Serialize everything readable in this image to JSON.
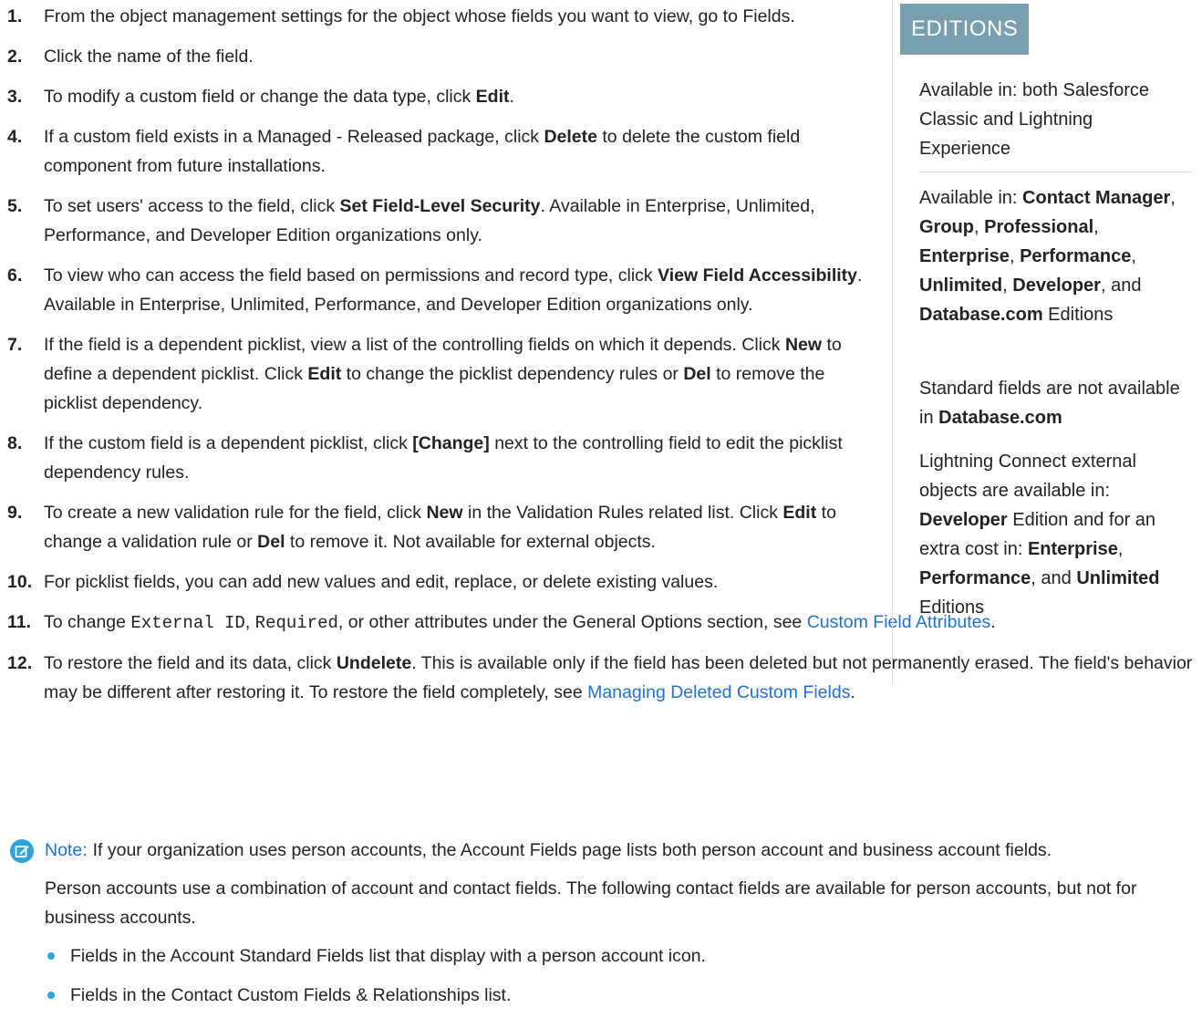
{
  "steps": [
    {
      "num": "1.",
      "parts": [
        {
          "t": "From the object management settings for the object whose fields you want to view, go to Fields."
        }
      ]
    },
    {
      "num": "2.",
      "parts": [
        {
          "t": "Click the name of the field."
        }
      ]
    },
    {
      "num": "3.",
      "parts": [
        {
          "t": "To modify a custom field or change the data type, click "
        },
        {
          "t": "Edit",
          "b": true
        },
        {
          "t": "."
        }
      ]
    },
    {
      "num": "4.",
      "parts": [
        {
          "t": "If a custom field exists in a Managed - Released package, click "
        },
        {
          "t": "Delete",
          "b": true
        },
        {
          "t": " to delete the custom field component from future installations."
        }
      ]
    },
    {
      "num": "5.",
      "parts": [
        {
          "t": "To set users' access to the field, click "
        },
        {
          "t": "Set Field-Level Security",
          "b": true
        },
        {
          "t": ". Available in Enterprise, Unlimited, Performance, and Developer Edition organizations only."
        }
      ]
    },
    {
      "num": "6.",
      "parts": [
        {
          "t": "To view who can access the field based on permissions and record type, click "
        },
        {
          "t": "View Field Accessibility",
          "b": true
        },
        {
          "t": ". Available in Enterprise, Unlimited, Performance, and Developer Edition organizations only."
        }
      ]
    },
    {
      "num": "7.",
      "parts": [
        {
          "t": "If the field is a dependent picklist, view a list of the controlling fields on which it depends. Click "
        },
        {
          "t": "New",
          "b": true
        },
        {
          "t": " to define a dependent picklist. Click "
        },
        {
          "t": "Edit",
          "b": true
        },
        {
          "t": " to change the picklist dependency rules or "
        },
        {
          "t": "Del",
          "b": true
        },
        {
          "t": " to remove the picklist dependency."
        }
      ]
    },
    {
      "num": "8.",
      "parts": [
        {
          "t": "If the custom field is a dependent picklist, click "
        },
        {
          "t": "[Change]",
          "b": true
        },
        {
          "t": " next to the controlling field to edit the picklist dependency rules."
        }
      ]
    },
    {
      "num": "9.",
      "parts": [
        {
          "t": "To create a new validation rule for the field, click "
        },
        {
          "t": "New",
          "b": true
        },
        {
          "t": " in the Validation Rules related list. Click "
        },
        {
          "t": "Edit",
          "b": true
        },
        {
          "t": " to change a validation rule or "
        },
        {
          "t": "Del",
          "b": true
        },
        {
          "t": " to remove it. Not available for external objects."
        }
      ]
    },
    {
      "num": "10.",
      "parts": [
        {
          "t": "For picklist fields, you can add new values and edit, replace, or delete existing values."
        }
      ]
    },
    {
      "num": "11.",
      "parts": [
        {
          "t": "To change "
        },
        {
          "t": "External ID",
          "m": true
        },
        {
          "t": ", "
        },
        {
          "t": "Required",
          "m": true
        },
        {
          "t": ", or other attributes under the General Options section, see "
        },
        {
          "t": "Custom Field Attributes",
          "l": true
        },
        {
          "t": "."
        }
      ]
    },
    {
      "num": "12.",
      "parts": [
        {
          "t": "To restore the field and its data, click "
        },
        {
          "t": "Undelete",
          "b": true
        },
        {
          "t": ". This is available only if the field has been deleted but not permanently erased. The field's behavior may be different after restoring it. To restore the field completely, see "
        },
        {
          "t": "Managing Deleted Custom Fields",
          "l": true
        },
        {
          "t": "."
        }
      ]
    }
  ],
  "sidebar": {
    "tag": "EDITIONS",
    "blocks": [
      {
        "parts": [
          {
            "t": "Available in: both Salesforce Classic and Lightning Experience"
          }
        ]
      },
      {
        "parts": [
          {
            "t": "Available in: "
          },
          {
            "t": "Contact Manager",
            "b": true
          },
          {
            "t": ", "
          },
          {
            "t": "Group",
            "b": true
          },
          {
            "t": ", "
          },
          {
            "t": "Professional",
            "b": true
          },
          {
            "t": ", "
          },
          {
            "t": "Enterprise",
            "b": true
          },
          {
            "t": ", "
          },
          {
            "t": "Performance",
            "b": true
          },
          {
            "t": ", "
          },
          {
            "t": "Unlimited",
            "b": true
          },
          {
            "t": ", "
          },
          {
            "t": "Developer",
            "b": true
          },
          {
            "t": ", and "
          },
          {
            "t": "Database.com",
            "b": true
          },
          {
            "t": " Editions"
          }
        ]
      },
      {
        "parts": [
          {
            "t": "Standard fields are not available in "
          },
          {
            "t": "Database.com",
            "b": true
          }
        ]
      },
      {
        "parts": [
          {
            "t": "Lightning Connect external objects are available in: "
          },
          {
            "t": "Developer",
            "b": true
          },
          {
            "t": " Edition and for an extra cost in: "
          },
          {
            "t": "Enterprise",
            "b": true
          },
          {
            "t": ", "
          },
          {
            "t": "Performance",
            "b": true
          },
          {
            "t": ", and "
          },
          {
            "t": "Unlimited",
            "b": true
          },
          {
            "t": " Editions"
          }
        ]
      }
    ]
  },
  "note": {
    "label": "Note:",
    "text1": "If your organization uses person accounts, the Account Fields page lists both person account and business account fields.",
    "text2": "Person accounts use a combination of account and contact fields. The following contact fields are available for person accounts, but not for business accounts.",
    "bullets": [
      "Fields in the Account Standard Fields list that display with a person account icon.",
      "Fields in the Contact Custom Fields & Relationships list."
    ],
    "accent": "#2ea3e0"
  },
  "colors": {
    "link": "#1e72d6",
    "editions_tag_bg": "#779faf"
  }
}
